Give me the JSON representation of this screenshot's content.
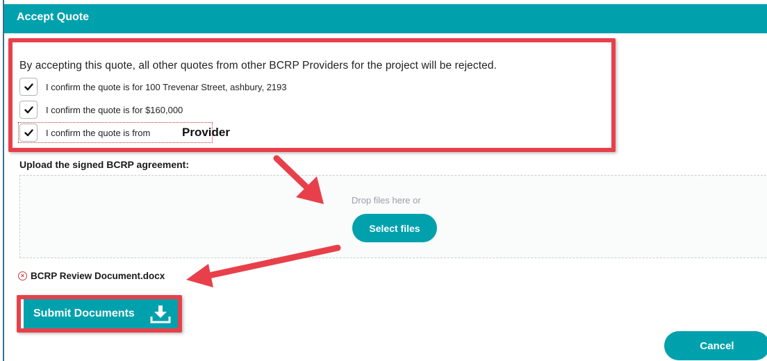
{
  "modal": {
    "title": "Accept Quote",
    "intro": "By accepting this quote, all other quotes from other BCRP Providers for the project will be rejected.",
    "confirmations": [
      {
        "label": "I confirm the quote is for 100 Trevenar Street, ashbury, 2193",
        "checked": true
      },
      {
        "label": "I confirm the quote is for $160,000",
        "checked": true
      },
      {
        "label": "I confirm the quote is from",
        "checked": true
      }
    ],
    "provider": "Provider",
    "upload": {
      "label": "Upload the signed BCRP agreement:",
      "drop_hint": "Drop files here or",
      "select_button": "Select files",
      "file_name": "BCRP Review Document.docx"
    },
    "submit_button": "Submit Documents",
    "cancel_button": "Cancel"
  },
  "colors": {
    "primary": "#00a1ad",
    "annotation": "#e8404a",
    "remove": "#d03a3a"
  },
  "icons": {
    "check": "check-icon",
    "remove": "remove-file-icon",
    "download": "download-icon"
  }
}
